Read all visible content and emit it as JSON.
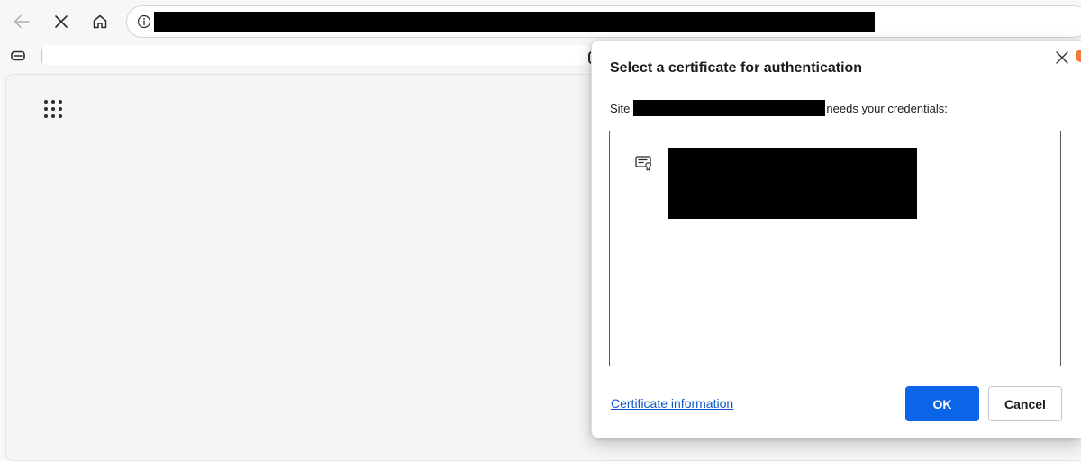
{
  "browser": {
    "url": "",
    "icons": {
      "back": "back-arrow-icon",
      "stop": "close-icon",
      "home": "home-icon",
      "site_info": "info-icon",
      "tab": "tab-icon"
    }
  },
  "page": {
    "launcher_icon": "app-launcher-grid-icon"
  },
  "dialog": {
    "title": "Select a certificate for authentication",
    "site_prefix": "Site",
    "site_name": "",
    "site_suffix": "needs your credentials:",
    "certificates": [
      {
        "name": "",
        "icon": "certificate-icon"
      }
    ],
    "certificate_info_link": "Certificate information",
    "ok_label": "OK",
    "cancel_label": "Cancel",
    "close_icon": "close-icon"
  },
  "colors": {
    "primary_button": "#0c64e8",
    "link": "#0f57c7",
    "redaction": "#000000",
    "toolbar_bg": "#f7f7f7",
    "peek_accent": "#f07a3b"
  }
}
